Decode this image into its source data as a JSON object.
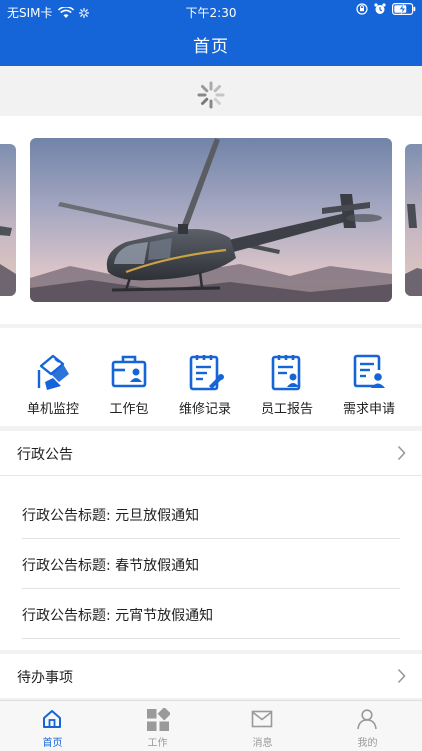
{
  "status_bar": {
    "carrier": "无SIM卡",
    "time": "下午2:30"
  },
  "nav": {
    "title": "首页"
  },
  "quick_actions": [
    {
      "label": "单机监控",
      "icon": "aircraft-monitor-icon"
    },
    {
      "label": "工作包",
      "icon": "briefcase-icon"
    },
    {
      "label": "维修记录",
      "icon": "maintenance-record-icon"
    },
    {
      "label": "员工报告",
      "icon": "employee-report-icon"
    },
    {
      "label": "需求申请",
      "icon": "request-application-icon"
    }
  ],
  "admin_notices": {
    "title": "行政公告",
    "items": [
      "行政公告标题: 元旦放假通知",
      "行政公告标题: 春节放假通知",
      "行政公告标题: 元宵节放假通知"
    ]
  },
  "todo": {
    "title": "待办事项"
  },
  "tabs": [
    {
      "label": "首页",
      "icon": "home-icon",
      "active": true
    },
    {
      "label": "工作",
      "icon": "work-grid-icon",
      "active": false
    },
    {
      "label": "消息",
      "icon": "message-icon",
      "active": false
    },
    {
      "label": "我的",
      "icon": "profile-icon",
      "active": false
    }
  ],
  "colors": {
    "primary": "#1565d8",
    "inactive": "#999999"
  }
}
